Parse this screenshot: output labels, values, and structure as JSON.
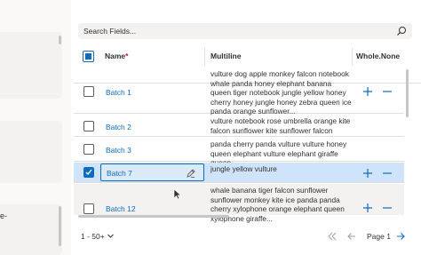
{
  "left": {
    "text": "e-"
  },
  "search": {
    "placeholder": "Search Fields..."
  },
  "columns": {
    "name": "Name",
    "required_marker": "*",
    "multiline": "Multiline",
    "whole": "Whole.None"
  },
  "rows": [
    {
      "name": "Batch 1",
      "multiline": "vulture dog apple monkey falcon notebook whale panda honey elephant banana queen tiger notebook jungle yellow honey cherry honey jungle honey zebra queen ice panda orange sunflower...",
      "checked": false
    },
    {
      "name": "Batch 2",
      "multiline": "vulture notebook rose umbrella orange kite falcon sunflower kite sunflower falcon",
      "checked": false
    },
    {
      "name": "Batch 3",
      "multiline": "panda cherry panda vulture vulture honey queen elephant vulture elephant giraffe queen...",
      "checked": false
    },
    {
      "name": "Batch 7",
      "multiline": "jungle yellow vulture",
      "checked": true
    },
    {
      "name": "Batch 12",
      "multiline": "whale banana tiger falcon sunflower sunflower monkey kite ice panda panda cherry xylophone orange elephant queen xylophone giraffe...",
      "checked": false
    }
  ],
  "footer": {
    "range": "1 - 50+",
    "page_label": "Page 1"
  },
  "colors": {
    "accent": "#0f6cbd",
    "selected_row": "#cfe4fa",
    "required": "#c50f1f"
  }
}
